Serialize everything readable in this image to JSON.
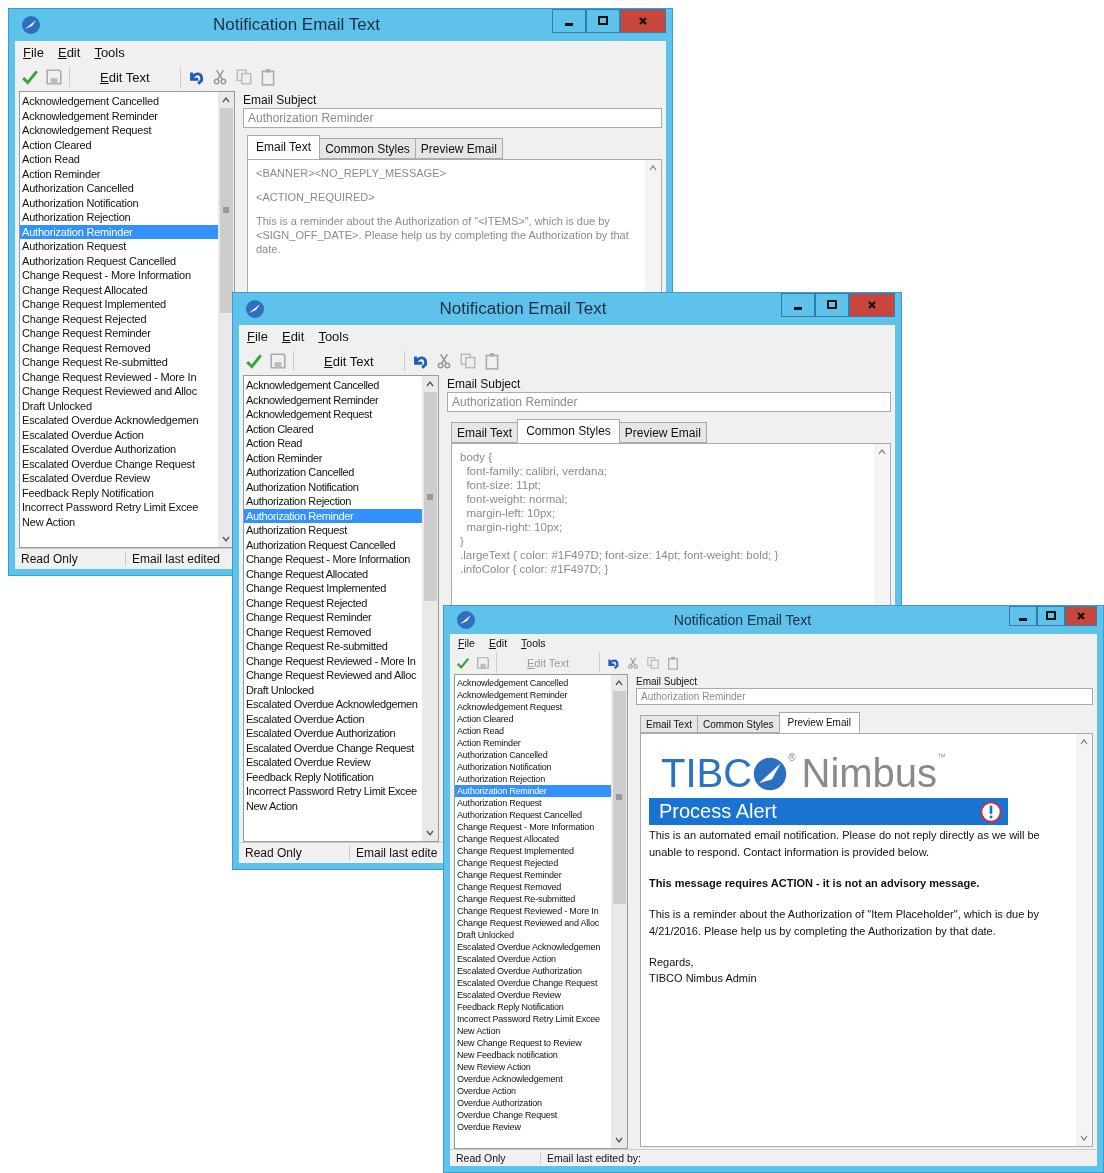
{
  "windows": [
    {
      "title": "Notification Email Text",
      "menu": [
        "File",
        "Edit",
        "Tools"
      ],
      "toolbar": {
        "edit_text": {
          "label": "Edit Text",
          "disabled": false
        }
      },
      "list": [
        {
          "label": "Acknowledgement Cancelled",
          "selected": false
        },
        {
          "label": "Acknowledgement Reminder",
          "selected": false
        },
        {
          "label": "Acknowledgement Request",
          "selected": false
        },
        {
          "label": "Action Cleared",
          "selected": false
        },
        {
          "label": "Action Read",
          "selected": false
        },
        {
          "label": "Action Reminder",
          "selected": false
        },
        {
          "label": "Authorization Cancelled",
          "selected": false
        },
        {
          "label": "Authorization Notification",
          "selected": false
        },
        {
          "label": "Authorization Rejection",
          "selected": false
        },
        {
          "label": "Authorization Reminder",
          "selected": true
        },
        {
          "label": "Authorization Request",
          "selected": false
        },
        {
          "label": "Authorization Request Cancelled",
          "selected": false
        },
        {
          "label": "Change Request - More Information",
          "selected": false
        },
        {
          "label": "Change Request Allocated",
          "selected": false
        },
        {
          "label": "Change Request Implemented",
          "selected": false
        },
        {
          "label": "Change Request Rejected",
          "selected": false
        },
        {
          "label": "Change Request Reminder",
          "selected": false
        },
        {
          "label": "Change Request Removed",
          "selected": false
        },
        {
          "label": "Change Request Re-submitted",
          "selected": false
        },
        {
          "label": "Change Request Reviewed - More In",
          "selected": false
        },
        {
          "label": "Change Request Reviewed and Alloc",
          "selected": false
        },
        {
          "label": "Draft Unlocked",
          "selected": false
        },
        {
          "label": "Escalated Overdue Acknowledgemen",
          "selected": false
        },
        {
          "label": "Escalated Overdue Action",
          "selected": false
        },
        {
          "label": "Escalated Overdue Authorization",
          "selected": false
        },
        {
          "label": "Escalated Overdue Change Request",
          "selected": false
        },
        {
          "label": "Escalated Overdue Review",
          "selected": false
        },
        {
          "label": "Feedback Reply Notification",
          "selected": false
        },
        {
          "label": "Incorrect Password Retry Limit Excee",
          "selected": false
        },
        {
          "label": "New Action",
          "selected": false
        }
      ],
      "subject": {
        "label": "Email Subject",
        "value": "Authorization Reminder"
      },
      "tabs": [
        {
          "label": "Email Text",
          "selected": true
        },
        {
          "label": "Common Styles",
          "selected": false
        },
        {
          "label": "Preview Email",
          "selected": false
        }
      ],
      "content": {
        "kind": "email_text",
        "lines": [
          "<BANNER><NO_REPLY_MESSAGE>",
          "<ACTION_REQUIRED>",
          "This is a reminder about the Authorization of \"<ITEMS>\", which is due by <SIGN_OFF_DATE>. Please help us by completing the Authorization by that date."
        ]
      },
      "status": [
        "Read Only",
        "Email last edited"
      ]
    },
    {
      "title": "Notification Email Text",
      "menu": [
        "File",
        "Edit",
        "Tools"
      ],
      "toolbar": {
        "edit_text": {
          "label": "Edit Text",
          "disabled": false
        }
      },
      "list": [
        {
          "label": "Acknowledgement Cancelled",
          "selected": false
        },
        {
          "label": "Acknowledgement Reminder",
          "selected": false
        },
        {
          "label": "Acknowledgement Request",
          "selected": false
        },
        {
          "label": "Action Cleared",
          "selected": false
        },
        {
          "label": "Action Read",
          "selected": false
        },
        {
          "label": "Action Reminder",
          "selected": false
        },
        {
          "label": "Authorization Cancelled",
          "selected": false
        },
        {
          "label": "Authorization Notification",
          "selected": false
        },
        {
          "label": "Authorization Rejection",
          "selected": false
        },
        {
          "label": "Authorization Reminder",
          "selected": true
        },
        {
          "label": "Authorization Request",
          "selected": false
        },
        {
          "label": "Authorization Request Cancelled",
          "selected": false
        },
        {
          "label": "Change Request - More Information",
          "selected": false
        },
        {
          "label": "Change Request Allocated",
          "selected": false
        },
        {
          "label": "Change Request Implemented",
          "selected": false
        },
        {
          "label": "Change Request Rejected",
          "selected": false
        },
        {
          "label": "Change Request Reminder",
          "selected": false
        },
        {
          "label": "Change Request Removed",
          "selected": false
        },
        {
          "label": "Change Request Re-submitted",
          "selected": false
        },
        {
          "label": "Change Request Reviewed - More In",
          "selected": false
        },
        {
          "label": "Change Request Reviewed and Alloc",
          "selected": false
        },
        {
          "label": "Draft Unlocked",
          "selected": false
        },
        {
          "label": "Escalated Overdue Acknowledgemen",
          "selected": false
        },
        {
          "label": "Escalated Overdue Action",
          "selected": false
        },
        {
          "label": "Escalated Overdue Authorization",
          "selected": false
        },
        {
          "label": "Escalated Overdue Change Request",
          "selected": false
        },
        {
          "label": "Escalated Overdue Review",
          "selected": false
        },
        {
          "label": "Feedback Reply Notification",
          "selected": false
        },
        {
          "label": "Incorrect Password Retry Limit Excee",
          "selected": false
        },
        {
          "label": "New Action",
          "selected": false
        }
      ],
      "subject": {
        "label": "Email Subject",
        "value": "Authorization Reminder"
      },
      "tabs": [
        {
          "label": "Email Text",
          "selected": false
        },
        {
          "label": "Common Styles",
          "selected": true
        },
        {
          "label": "Preview Email",
          "selected": false
        }
      ],
      "content": {
        "kind": "styles",
        "lines": [
          "body {",
          "  font-family: calibri, verdana;",
          "  font-size: 11pt;",
          "  font-weight: normal;",
          "  margin-left: 10px;",
          "  margin-right: 10px;",
          "}",
          ".largeText { color: #1F497D; font-size: 14pt; font-weight: bold; }",
          ".infoColor { color: #1F497D; }"
        ]
      },
      "status": [
        "Read Only",
        "Email last edite"
      ]
    },
    {
      "title": "Notification Email Text",
      "menu": [
        "File",
        "Edit",
        "Tools"
      ],
      "toolbar": {
        "edit_text": {
          "label": "Edit Text",
          "disabled": true
        }
      },
      "list": [
        {
          "label": "Acknowledgement Cancelled",
          "selected": false
        },
        {
          "label": "Acknowledgement Reminder",
          "selected": false
        },
        {
          "label": "Acknowledgement Request",
          "selected": false
        },
        {
          "label": "Action Cleared",
          "selected": false
        },
        {
          "label": "Action Read",
          "selected": false
        },
        {
          "label": "Action Reminder",
          "selected": false
        },
        {
          "label": "Authorization Cancelled",
          "selected": false
        },
        {
          "label": "Authorization Notification",
          "selected": false
        },
        {
          "label": "Authorization Rejection",
          "selected": false
        },
        {
          "label": "Authorization Reminder",
          "selected": true
        },
        {
          "label": "Authorization Request",
          "selected": false
        },
        {
          "label": "Authorization Request Cancelled",
          "selected": false
        },
        {
          "label": "Change Request - More Information",
          "selected": false
        },
        {
          "label": "Change Request Allocated",
          "selected": false
        },
        {
          "label": "Change Request Implemented",
          "selected": false
        },
        {
          "label": "Change Request Rejected",
          "selected": false
        },
        {
          "label": "Change Request Reminder",
          "selected": false
        },
        {
          "label": "Change Request Removed",
          "selected": false
        },
        {
          "label": "Change Request Re-submitted",
          "selected": false
        },
        {
          "label": "Change Request Reviewed - More In",
          "selected": false
        },
        {
          "label": "Change Request Reviewed and Alloc",
          "selected": false
        },
        {
          "label": "Draft Unlocked",
          "selected": false
        },
        {
          "label": "Escalated Overdue Acknowledgemen",
          "selected": false
        },
        {
          "label": "Escalated Overdue Action",
          "selected": false
        },
        {
          "label": "Escalated Overdue Authorization",
          "selected": false
        },
        {
          "label": "Escalated Overdue Change Request",
          "selected": false
        },
        {
          "label": "Escalated Overdue Review",
          "selected": false
        },
        {
          "label": "Feedback Reply Notification",
          "selected": false
        },
        {
          "label": "Incorrect Password Retry Limit Excee",
          "selected": false
        },
        {
          "label": "New Action",
          "selected": false
        },
        {
          "label": "New Change Request to Review",
          "selected": false
        },
        {
          "label": "New Feedback notification",
          "selected": false
        },
        {
          "label": "New Review Action",
          "selected": false
        },
        {
          "label": "Overdue Acknowledgement",
          "selected": false
        },
        {
          "label": "Overdue Action",
          "selected": false
        },
        {
          "label": "Overdue Authorization",
          "selected": false
        },
        {
          "label": "Overdue Change Request",
          "selected": false
        },
        {
          "label": "Overdue Review",
          "selected": false
        }
      ],
      "subject": {
        "label": "Email Subject",
        "value": "Authorization Reminder"
      },
      "tabs": [
        {
          "label": "Email Text",
          "selected": false
        },
        {
          "label": "Common Styles",
          "selected": false
        },
        {
          "label": "Preview Email",
          "selected": true
        }
      ],
      "content": {
        "kind": "preview",
        "logo_left": "TIBC",
        "registered_mark": "®",
        "logo_right": "Nimbus",
        "trademark": "™",
        "banner": "Process Alert",
        "paragraphs": [
          {
            "text": "This is an automated email notification. Please do not reply directly as we will be unable to respond. Contact information is provided below.",
            "bold": false
          },
          {
            "text": "This message requires ACTION - it is not an advisory message.",
            "bold": true
          },
          {
            "text": "This is a reminder about the Authorization of \"Item Placeholder\", which is due by 4/21/2016. Please help us by completing the Authorization by that date.",
            "bold": false
          }
        ],
        "signature": [
          "Regards,",
          "TIBCO Nimbus Admin"
        ]
      },
      "status": [
        "Read Only",
        "Email last edited by:"
      ]
    }
  ]
}
